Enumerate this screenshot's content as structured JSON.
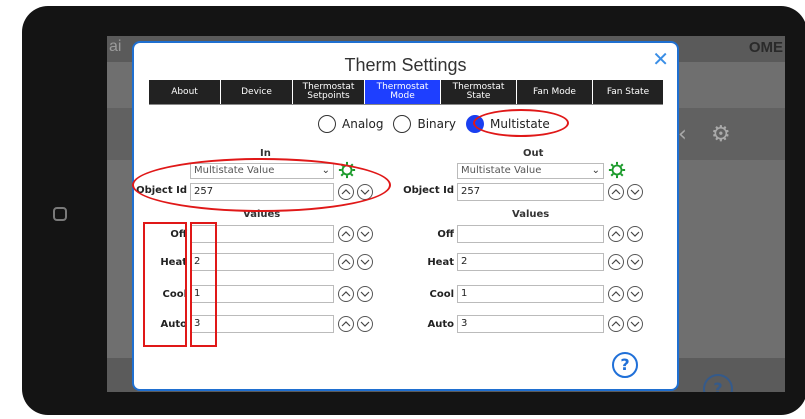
{
  "background": {
    "logo_fragment": "ai",
    "brand_fragment": "OME",
    "help_glyph": "?"
  },
  "dialog": {
    "title": "Therm Settings",
    "close_glyph": "✕",
    "tabs": [
      {
        "label": "About",
        "active": false
      },
      {
        "label": "Device",
        "active": false
      },
      {
        "label": "Thermostat Setpoints",
        "active": false
      },
      {
        "label": "Thermostat Mode",
        "active": true
      },
      {
        "label": "Thermostat State",
        "active": false
      },
      {
        "label": "Fan Mode",
        "active": false
      },
      {
        "label": "Fan State",
        "active": false
      }
    ],
    "type_options": [
      {
        "label": "Analog",
        "checked": false
      },
      {
        "label": "Binary",
        "checked": false
      },
      {
        "label": "Multistate",
        "checked": true
      }
    ],
    "in": {
      "heading": "In",
      "select_value": "Multistate Value",
      "object_id_label": "Object Id",
      "object_id": "257",
      "values_heading": "Values",
      "rows": [
        {
          "label": "Off",
          "value": ""
        },
        {
          "label": "Heat",
          "value": "2"
        },
        {
          "label": "Cool",
          "value": "1"
        },
        {
          "label": "Auto",
          "value": "3"
        }
      ]
    },
    "out": {
      "heading": "Out",
      "select_value": "Multistate Value",
      "object_id_label": "Object Id",
      "object_id": "257",
      "values_heading": "Values",
      "rows": [
        {
          "label": "Off",
          "value": ""
        },
        {
          "label": "Heat",
          "value": "2"
        },
        {
          "label": "Cool",
          "value": "1"
        },
        {
          "label": "Auto",
          "value": "3"
        }
      ]
    },
    "help_glyph": "?"
  },
  "colors": {
    "active_tab": "#1e3fff",
    "annotation": "#e01818",
    "gear_green": "#1a9a2a"
  }
}
